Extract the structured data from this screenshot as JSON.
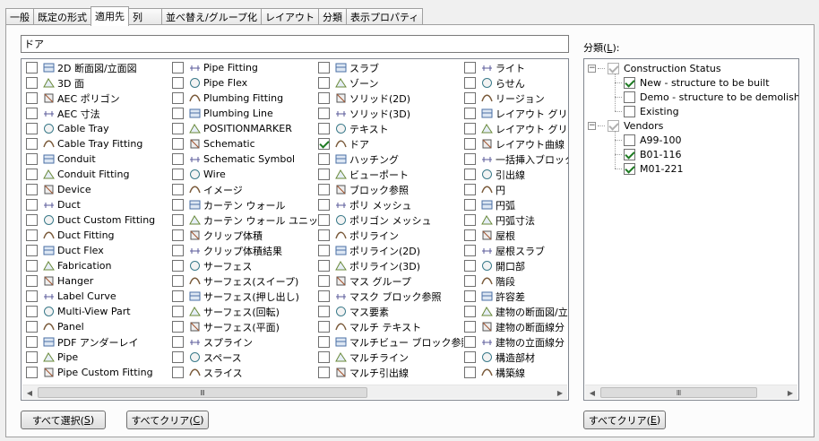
{
  "tabs": [
    {
      "label": "一般",
      "active": false
    },
    {
      "label": "既定の形式",
      "active": false
    },
    {
      "label": "適用先",
      "active": true
    },
    {
      "label": "列",
      "active": false
    },
    {
      "label": "並べ替え/グループ化",
      "active": false
    },
    {
      "label": "レイアウト",
      "active": false
    },
    {
      "label": "分類",
      "active": false
    },
    {
      "label": "表示プロパティ",
      "active": false
    }
  ],
  "search": {
    "value": "ドア"
  },
  "object_columns": [
    [
      {
        "label": "2D 断面図/立面図",
        "checked": false,
        "icon": "section-elevation-icon"
      },
      {
        "label": "3D 面",
        "checked": false,
        "icon": "3d-face-icon"
      },
      {
        "label": "AEC ポリゴン",
        "checked": false,
        "icon": "aec-polygon-icon"
      },
      {
        "label": "AEC 寸法",
        "checked": false,
        "icon": "aec-dimension-icon"
      },
      {
        "label": "Cable Tray",
        "checked": false,
        "icon": "cable-tray-icon"
      },
      {
        "label": "Cable Tray Fitting",
        "checked": false,
        "icon": "cable-tray-fitting-icon"
      },
      {
        "label": "Conduit",
        "checked": false,
        "icon": "conduit-icon"
      },
      {
        "label": "Conduit Fitting",
        "checked": false,
        "icon": "conduit-fitting-icon"
      },
      {
        "label": "Device",
        "checked": false,
        "icon": "device-icon"
      },
      {
        "label": "Duct",
        "checked": false,
        "icon": "duct-icon"
      },
      {
        "label": "Duct Custom Fitting",
        "checked": false,
        "icon": "duct-custom-fitting-icon"
      },
      {
        "label": "Duct Fitting",
        "checked": false,
        "icon": "duct-fitting-icon"
      },
      {
        "label": "Duct Flex",
        "checked": false,
        "icon": "duct-flex-icon"
      },
      {
        "label": "Fabrication",
        "checked": false,
        "icon": "fabrication-icon"
      },
      {
        "label": "Hanger",
        "checked": false,
        "icon": "hanger-icon"
      },
      {
        "label": "Label Curve",
        "checked": false,
        "icon": "label-curve-icon"
      },
      {
        "label": "Multi-View Part",
        "checked": false,
        "icon": "multi-view-part-icon"
      },
      {
        "label": "Panel",
        "checked": false,
        "icon": "panel-icon"
      },
      {
        "label": "PDF アンダーレイ",
        "checked": false,
        "icon": "pdf-underlay-icon"
      },
      {
        "label": "Pipe",
        "checked": false,
        "icon": "pipe-icon"
      },
      {
        "label": "Pipe Custom Fitting",
        "checked": false,
        "icon": "pipe-custom-fitting-icon"
      }
    ],
    [
      {
        "label": "Pipe Fitting",
        "checked": false,
        "icon": "pipe-fitting-icon"
      },
      {
        "label": "Pipe Flex",
        "checked": false,
        "icon": "pipe-flex-icon"
      },
      {
        "label": "Plumbing Fitting",
        "checked": false,
        "icon": "plumbing-fitting-icon"
      },
      {
        "label": "Plumbing Line",
        "checked": false,
        "icon": "plumbing-line-icon"
      },
      {
        "label": "POSITIONMARKER",
        "checked": false,
        "icon": "position-marker-icon"
      },
      {
        "label": "Schematic",
        "checked": false,
        "icon": "schematic-icon"
      },
      {
        "label": "Schematic Symbol",
        "checked": false,
        "icon": "schematic-symbol-icon"
      },
      {
        "label": "Wire",
        "checked": false,
        "icon": "wire-icon"
      },
      {
        "label": "イメージ",
        "checked": false,
        "icon": "image-icon"
      },
      {
        "label": "カーテン ウォール",
        "checked": false,
        "icon": "curtain-wall-icon"
      },
      {
        "label": "カーテン ウォール ユニット",
        "checked": false,
        "icon": "curtain-wall-unit-icon"
      },
      {
        "label": "クリップ体積",
        "checked": false,
        "icon": "clip-volume-icon"
      },
      {
        "label": "クリップ体積結果",
        "checked": false,
        "icon": "clip-volume-result-icon"
      },
      {
        "label": "サーフェス",
        "checked": false,
        "icon": "surface-icon"
      },
      {
        "label": "サーフェス(スイープ)",
        "checked": false,
        "icon": "surface-sweep-icon"
      },
      {
        "label": "サーフェス(押し出し)",
        "checked": false,
        "icon": "surface-extrude-icon"
      },
      {
        "label": "サーフェス(回転)",
        "checked": false,
        "icon": "surface-revolve-icon"
      },
      {
        "label": "サーフェス(平面)",
        "checked": false,
        "icon": "surface-planar-icon"
      },
      {
        "label": "スプライン",
        "checked": false,
        "icon": "spline-icon"
      },
      {
        "label": "スペース",
        "checked": false,
        "icon": "space-icon"
      },
      {
        "label": "スライス",
        "checked": false,
        "icon": "slice-icon"
      }
    ],
    [
      {
        "label": "スラブ",
        "checked": false,
        "icon": "slab-icon"
      },
      {
        "label": "ゾーン",
        "checked": false,
        "icon": "zone-icon"
      },
      {
        "label": "ソリッド(2D)",
        "checked": false,
        "icon": "solid-2d-icon"
      },
      {
        "label": "ソリッド(3D)",
        "checked": false,
        "icon": "solid-3d-icon"
      },
      {
        "label": "テキスト",
        "checked": false,
        "icon": "text-icon"
      },
      {
        "label": "ドア",
        "checked": true,
        "icon": "door-icon"
      },
      {
        "label": "ハッチング",
        "checked": false,
        "icon": "hatch-icon"
      },
      {
        "label": "ビューポート",
        "checked": false,
        "icon": "viewport-icon"
      },
      {
        "label": "ブロック参照",
        "checked": false,
        "icon": "block-reference-icon"
      },
      {
        "label": "ポリ メッシュ",
        "checked": false,
        "icon": "poly-mesh-icon"
      },
      {
        "label": "ポリゴン メッシュ",
        "checked": false,
        "icon": "polygon-mesh-icon"
      },
      {
        "label": "ポリライン",
        "checked": false,
        "icon": "polyline-icon"
      },
      {
        "label": "ポリライン(2D)",
        "checked": false,
        "icon": "polyline-2d-icon"
      },
      {
        "label": "ポリライン(3D)",
        "checked": false,
        "icon": "polyline-3d-icon"
      },
      {
        "label": "マス グループ",
        "checked": false,
        "icon": "mass-group-icon"
      },
      {
        "label": "マスク ブロック参照",
        "checked": false,
        "icon": "mask-block-reference-icon"
      },
      {
        "label": "マス要素",
        "checked": false,
        "icon": "mass-element-icon"
      },
      {
        "label": "マルチ テキスト",
        "checked": false,
        "icon": "mtext-icon"
      },
      {
        "label": "マルチビュー ブロック参照",
        "checked": false,
        "icon": "multi-view-block-icon"
      },
      {
        "label": "マルチライン",
        "checked": false,
        "icon": "multiline-icon"
      },
      {
        "label": "マルチ引出線",
        "checked": false,
        "icon": "multileader-icon"
      }
    ],
    [
      {
        "label": "ライト",
        "checked": false,
        "icon": "light-icon"
      },
      {
        "label": "らせん",
        "checked": false,
        "icon": "helix-icon"
      },
      {
        "label": "リージョン",
        "checked": false,
        "icon": "region-icon"
      },
      {
        "label": "レイアウト グリッド",
        "checked": false,
        "icon": "layout-grid-icon"
      },
      {
        "label": "レイアウト グリッド",
        "checked": false,
        "icon": "layout-grid-3d-icon"
      },
      {
        "label": "レイアウト曲線",
        "checked": false,
        "icon": "layout-curve-icon"
      },
      {
        "label": "一括挿入ブロック",
        "checked": false,
        "icon": "minsert-block-icon"
      },
      {
        "label": "引出線",
        "checked": false,
        "icon": "leader-icon"
      },
      {
        "label": "円",
        "checked": false,
        "icon": "circle-icon"
      },
      {
        "label": "円弧",
        "checked": false,
        "icon": "arc-icon"
      },
      {
        "label": "円弧寸法",
        "checked": false,
        "icon": "arc-dimension-icon"
      },
      {
        "label": "屋根",
        "checked": false,
        "icon": "roof-icon"
      },
      {
        "label": "屋根スラブ",
        "checked": false,
        "icon": "roof-slab-icon"
      },
      {
        "label": "開口部",
        "checked": false,
        "icon": "opening-icon"
      },
      {
        "label": "階段",
        "checked": false,
        "icon": "stair-icon"
      },
      {
        "label": "許容差",
        "checked": false,
        "icon": "tolerance-icon"
      },
      {
        "label": "建物の断面図/立",
        "checked": false,
        "icon": "building-section-icon"
      },
      {
        "label": "建物の断面線分",
        "checked": false,
        "icon": "building-section-line-icon"
      },
      {
        "label": "建物の立面線分",
        "checked": false,
        "icon": "building-elevation-line-icon"
      },
      {
        "label": "構造部材",
        "checked": false,
        "icon": "structural-member-icon"
      },
      {
        "label": "構築線",
        "checked": false,
        "icon": "xline-icon"
      }
    ]
  ],
  "buttons": {
    "select_all": {
      "label": "すべて選択(",
      "key": "S",
      "suffix": ")"
    },
    "clear_all": {
      "label": "すべてクリア(",
      "key": "C",
      "suffix": ")"
    },
    "clear_all_cat": {
      "label": "すべてクリア(",
      "key": "E",
      "suffix": ")"
    }
  },
  "classification": {
    "label": "分類(",
    "key": "L",
    "suffix": "):",
    "tree": [
      {
        "label": "Construction Status",
        "checked": true,
        "gray": true,
        "children": [
          {
            "label": "New - structure to be built",
            "checked": true
          },
          {
            "label": "Demo - structure to be demolished",
            "checked": false
          },
          {
            "label": "Existing",
            "checked": false
          }
        ]
      },
      {
        "label": "Vendors",
        "checked": true,
        "gray": true,
        "children": [
          {
            "label": "A99-100",
            "checked": false
          },
          {
            "label": "B01-116",
            "checked": true
          },
          {
            "label": "M01-221",
            "checked": true
          }
        ]
      }
    ]
  },
  "scrollbar": {
    "left_arrow": "◀",
    "right_arrow": "▶",
    "grip": "Ⅲ"
  },
  "expander_glyph": "−"
}
